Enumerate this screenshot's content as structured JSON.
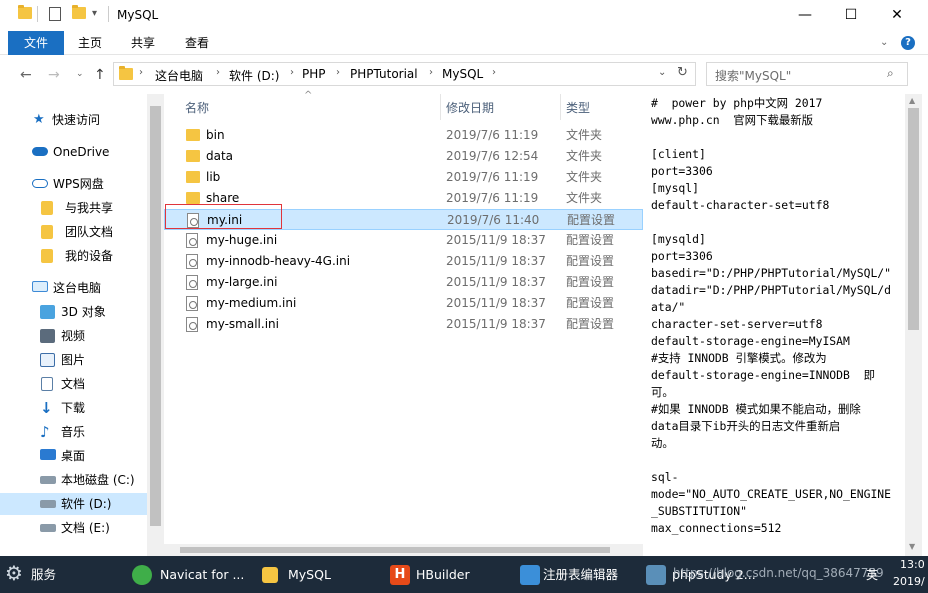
{
  "window": {
    "title": "MySQL",
    "minimize": "—",
    "maximize": "☐",
    "close": "✕"
  },
  "ribbon": {
    "tabs": [
      "文件",
      "主页",
      "共享",
      "查看"
    ]
  },
  "address": {
    "crumbs": [
      "这台电脑",
      "软件 (D:)",
      "PHP",
      "PHPTutorial",
      "MySQL"
    ],
    "search_placeholder": "搜索\"MySQL\""
  },
  "sidebar": {
    "items": [
      {
        "label": "快速访问",
        "icon": "star-icon"
      },
      {
        "label": "OneDrive",
        "icon": "cloud-icon"
      },
      {
        "label": "WPS网盘",
        "icon": "cloud-outline-icon"
      },
      {
        "label": "与我共享",
        "icon": "folder-icon"
      },
      {
        "label": "团队文档",
        "icon": "folder-icon"
      },
      {
        "label": "我的设备",
        "icon": "folder-icon"
      },
      {
        "label": "这台电脑",
        "icon": "computer-icon"
      },
      {
        "label": "3D 对象",
        "icon": "cube-icon"
      },
      {
        "label": "视频",
        "icon": "video-icon"
      },
      {
        "label": "图片",
        "icon": "image-icon"
      },
      {
        "label": "文档",
        "icon": "document-icon"
      },
      {
        "label": "下载",
        "icon": "download-icon"
      },
      {
        "label": "音乐",
        "icon": "music-icon"
      },
      {
        "label": "桌面",
        "icon": "desktop-icon"
      },
      {
        "label": "本地磁盘 (C:)",
        "icon": "drive-icon"
      },
      {
        "label": "软件 (D:)",
        "icon": "drive-icon"
      },
      {
        "label": "文档 (E:)",
        "icon": "drive-icon"
      }
    ]
  },
  "filelist": {
    "columns": [
      "名称",
      "修改日期",
      "类型"
    ],
    "rows": [
      {
        "name": "bin",
        "date": "2019/7/6 11:19",
        "type": "文件夹",
        "kind": "folder"
      },
      {
        "name": "data",
        "date": "2019/7/6 12:54",
        "type": "文件夹",
        "kind": "folder"
      },
      {
        "name": "lib",
        "date": "2019/7/6 11:19",
        "type": "文件夹",
        "kind": "folder"
      },
      {
        "name": "share",
        "date": "2019/7/6 11:19",
        "type": "文件夹",
        "kind": "folder"
      },
      {
        "name": "my.ini",
        "date": "2019/7/6 11:40",
        "type": "配置设置",
        "kind": "ini"
      },
      {
        "name": "my-huge.ini",
        "date": "2015/11/9 18:37",
        "type": "配置设置",
        "kind": "ini"
      },
      {
        "name": "my-innodb-heavy-4G.ini",
        "date": "2015/11/9 18:37",
        "type": "配置设置",
        "kind": "ini"
      },
      {
        "name": "my-large.ini",
        "date": "2015/11/9 18:37",
        "type": "配置设置",
        "kind": "ini"
      },
      {
        "name": "my-medium.ini",
        "date": "2015/11/9 18:37",
        "type": "配置设置",
        "kind": "ini"
      },
      {
        "name": "my-small.ini",
        "date": "2015/11/9 18:37",
        "type": "配置设置",
        "kind": "ini"
      }
    ]
  },
  "preview": {
    "lines": [
      "#  power by php中文网 2017",
      "www.php.cn  官网下载最新版",
      "",
      "[client]",
      "port=3306",
      "[mysql]",
      "default-character-set=utf8",
      "",
      "[mysqld]",
      "port=3306",
      "basedir=\"D:/PHP/PHPTutorial/MySQL/\"",
      "datadir=\"D:/PHP/PHPTutorial/MySQL/d",
      "ata/\"",
      "character-set-server=utf8",
      "default-storage-engine=MyISAM",
      "#支持 INNODB 引擎模式。修改为",
      "default-storage-engine=INNODB  即",
      "可。",
      "#如果 INNODB 模式如果不能启动，删除",
      "data目录下ib开头的日志文件重新启",
      "动。",
      "",
      "sql-",
      "mode=\"NO_AUTO_CREATE_USER,NO_ENGINE",
      "_SUBSTITUTION\"",
      "max_connections=512"
    ]
  },
  "taskbar": {
    "items": [
      {
        "label": "服务",
        "icon": "gear-icon"
      },
      {
        "label": "Navicat for ...",
        "icon": "navicat-icon"
      },
      {
        "label": "MySQL",
        "icon": "folder-icon"
      },
      {
        "label": "HBuilder",
        "icon": "hbuilder-icon"
      },
      {
        "label": "注册表编辑器",
        "icon": "registry-icon"
      },
      {
        "label": "phpStudy 2...",
        "icon": "phpstudy-icon"
      }
    ],
    "clock_time": "13:0",
    "clock_date": "2019/",
    "watermark": "https://blog.csdn.net/qq_38647759",
    "ime": "英"
  },
  "colors": {
    "accent": "#1a6fc2",
    "selection": "#cce8ff",
    "highlight_border": "#e0353b",
    "taskbar": "#1d2b3a"
  }
}
